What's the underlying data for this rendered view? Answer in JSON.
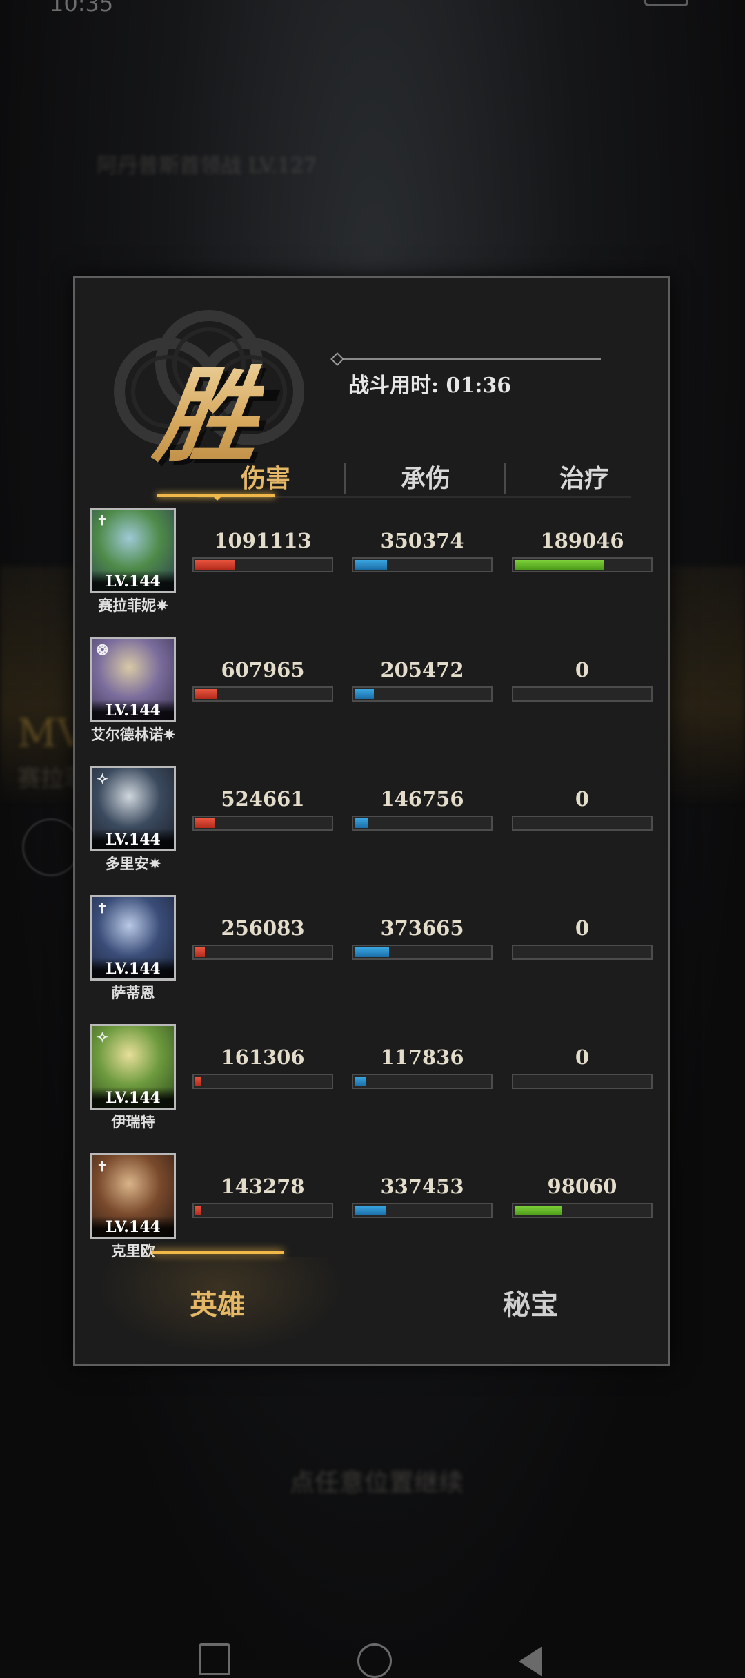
{
  "status_bar": {
    "time": "10:35"
  },
  "background": {
    "boss_label": "阿丹普斯首领战 LV.127",
    "mvp_label": "MV",
    "mvp_name": "赛拉菲",
    "continue_hint": "点任意位置继续"
  },
  "panel": {
    "result": "胜",
    "duration": "战斗用时: 01:36",
    "stat_tabs": [
      {
        "label": "伤害",
        "active": true
      },
      {
        "label": "承伤",
        "active": false
      },
      {
        "label": "治疗",
        "active": false
      }
    ],
    "heroes": [
      {
        "name": "赛拉菲妮",
        "star": "✷",
        "level": "LV.144",
        "class_icon": "✝",
        "portrait_colors": [
          "#9ec9d6",
          "#4e8a48",
          "#2b3e52"
        ],
        "damage": "1091113",
        "damage_frac": 1.0,
        "taken": "350374",
        "taken_frac": 0.94,
        "heal": "189046",
        "heal_frac": 1.0
      },
      {
        "name": "艾尔德林诺",
        "star": "✷",
        "level": "LV.144",
        "class_icon": "❂",
        "portrait_colors": [
          "#d8c9a6",
          "#7a6c9c",
          "#3b3350"
        ],
        "damage": "607965",
        "damage_frac": 0.56,
        "taken": "205472",
        "taken_frac": 0.55,
        "heal": "0",
        "heal_frac": 0
      },
      {
        "name": "多里安",
        "star": "✷",
        "level": "LV.144",
        "class_icon": "✧",
        "portrait_colors": [
          "#cfd6dd",
          "#3b4a5e",
          "#1a1f2a"
        ],
        "damage": "524661",
        "damage_frac": 0.48,
        "taken": "146756",
        "taken_frac": 0.39,
        "heal": "0",
        "heal_frac": 0
      },
      {
        "name": "萨蒂恩",
        "star": "",
        "level": "LV.144",
        "class_icon": "✝",
        "portrait_colors": [
          "#b9c9e6",
          "#3a4d78",
          "#1b2338"
        ],
        "damage": "256083",
        "damage_frac": 0.24,
        "taken": "373665",
        "taken_frac": 1.0,
        "heal": "0",
        "heal_frac": 0
      },
      {
        "name": "伊瑞特",
        "star": "",
        "level": "LV.144",
        "class_icon": "✧",
        "portrait_colors": [
          "#e7df9a",
          "#6d9a3e",
          "#2e4a1c"
        ],
        "damage": "161306",
        "damage_frac": 0.15,
        "taken": "117836",
        "taken_frac": 0.32,
        "heal": "0",
        "heal_frac": 0
      },
      {
        "name": "克里欧",
        "star": "",
        "level": "LV.144",
        "class_icon": "✝",
        "portrait_colors": [
          "#d9b48a",
          "#7a4a2c",
          "#2a1a12"
        ],
        "damage": "143278",
        "damage_frac": 0.13,
        "taken": "337453",
        "taken_frac": 0.9,
        "heal": "98060",
        "heal_frac": 0.52
      }
    ],
    "bottom_tabs": [
      {
        "label": "英雄",
        "active": true
      },
      {
        "label": "秘宝",
        "active": false
      }
    ]
  },
  "colors": {
    "damage": "#d9412c",
    "taken": "#2f8fcc",
    "heal": "#6cbf2e",
    "accent": "#e5b867"
  }
}
